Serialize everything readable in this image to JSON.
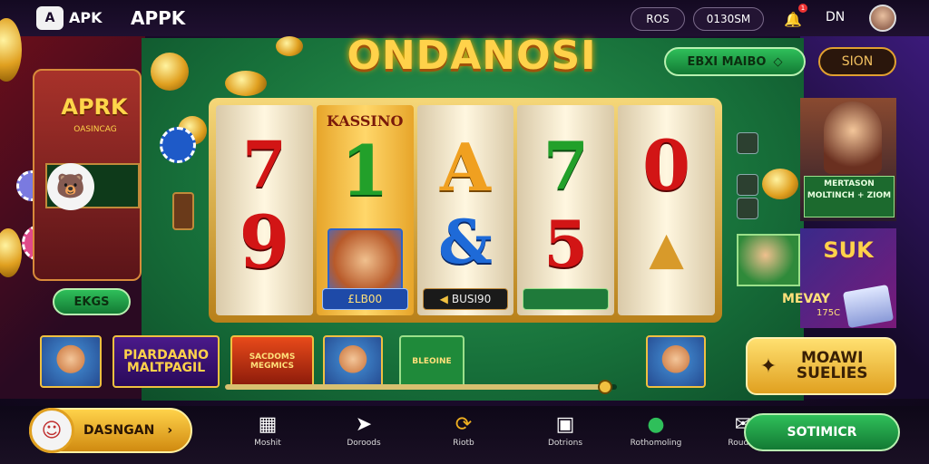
{
  "topbar": {
    "logo_badge": "A",
    "logo_text": "APK",
    "brand": "APPK",
    "pill_a": "ROS",
    "pill_b": "0130SM",
    "bell_icon": "bell-icon",
    "notification_count": "1",
    "lang": "DN"
  },
  "header": {
    "title": "ONDANOSI",
    "primary_button": "EBXI MAIBO",
    "sign_button": "SION"
  },
  "left_machine": {
    "label": "APRK",
    "sub": "OASINCAG",
    "button": "EKGS"
  },
  "reels": [
    {
      "tag": "",
      "symbols": [
        "7",
        "9"
      ],
      "footer": ""
    },
    {
      "tag": "KASSINO",
      "symbols": [
        "1"
      ],
      "footer": "£LB00"
    },
    {
      "tag": "",
      "symbols": [
        "A",
        "&"
      ],
      "footer": "BUSI90"
    },
    {
      "tag": "",
      "symbols": [
        "7",
        "5"
      ],
      "footer": ""
    },
    {
      "tag": "",
      "symbols": [
        "0"
      ],
      "footer": ""
    }
  ],
  "promos": {
    "promo1_text": "MERTASON MOLTINCH + ZIOM",
    "promo2_text": "SUK",
    "promo2_name": "MEVAY",
    "promo2_num": "175C"
  },
  "thumbnails": {
    "t2": "PIARDAANO MALTPAGIL",
    "t3": "SACDOMS MEGMICS",
    "t5": "BLEOINE"
  },
  "progress": {
    "value": 0.97
  },
  "bonus_button": "MOAWI SUELIES",
  "bottom": {
    "left_button": "DASNGAN",
    "nav": [
      {
        "icon": "grid-icon",
        "label": "Moshit"
      },
      {
        "icon": "send-icon",
        "label": "Doroods"
      },
      {
        "icon": "refresh-icon",
        "label": "Riotb"
      },
      {
        "icon": "calendar-icon",
        "label": "Dotrions"
      },
      {
        "icon": "gamepad-icon",
        "label": "Rothomoling"
      },
      {
        "icon": "chat-icon",
        "label": "Roudhs"
      }
    ],
    "right_button": "SOTIMICR"
  },
  "colors": {
    "felt": "#1f8443",
    "gold": "#ffd24a",
    "accent_green": "#2fbf5a"
  }
}
